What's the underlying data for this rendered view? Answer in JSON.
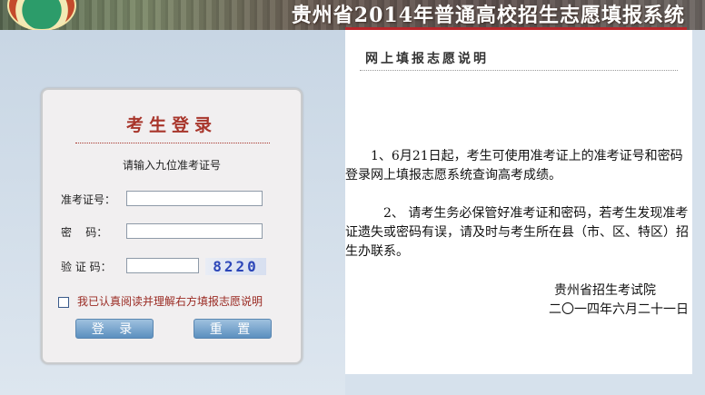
{
  "header": {
    "title": "贵州省2014年普通高校招生志愿填报系统",
    "emblem_icon": "exam-board-emblem-icon"
  },
  "login": {
    "title": "考生登录",
    "hint": "请输入九位准考证号",
    "ticket_label": "准考证号：",
    "password_label": "密    码：",
    "captcha_label": "验 证 码：",
    "ticket_value": "",
    "password_value": "",
    "captcha_value": "",
    "captcha_image_text": "8220",
    "agree_text": "我已认真阅读并理解右方填报志愿说明",
    "agree_checked": false,
    "login_button": "登 录",
    "reset_button": "重 置"
  },
  "info": {
    "title": "网上填报志愿说明",
    "paragraph1": "1、6月21日起，考生可使用准考证上的准考证号和密码登录网上填报志愿系统查询高考成绩。",
    "paragraph2": "2、 请考生务必保管好准考证和密码，若考生发现准考证遗失或密码有误，请及时与考生所在县（市、区、特区）招生办联系。",
    "signature_org": "贵州省招生考试院",
    "signature_date": "二〇一四年六月二十一日"
  },
  "colors": {
    "accent_red": "#a8352b",
    "button_blue": "#5b8fbf",
    "page_bg": "#d6e1ec"
  }
}
